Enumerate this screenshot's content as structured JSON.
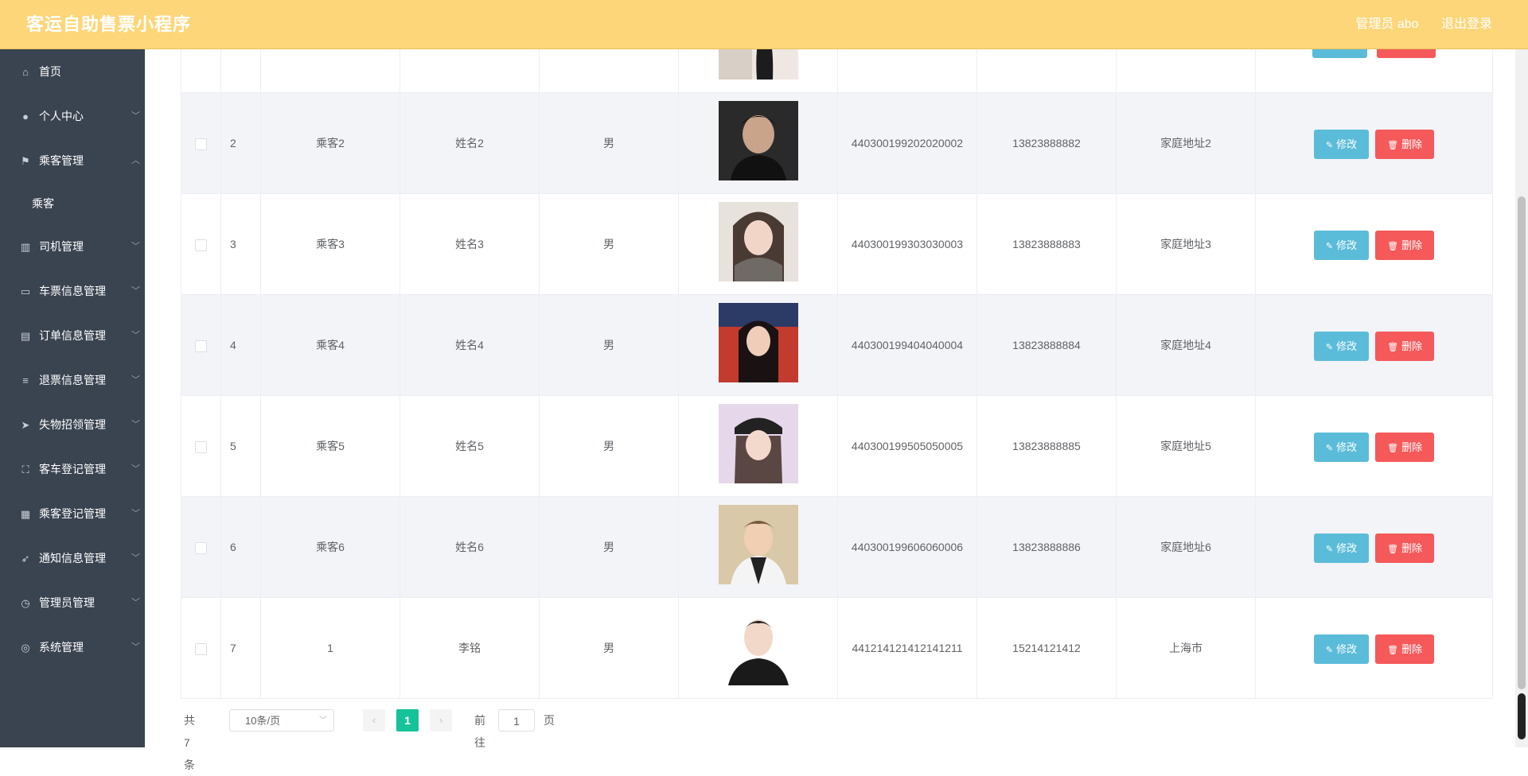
{
  "header": {
    "title": "客运自助售票小程序",
    "user_label": "管理员 abo",
    "logout_label": "退出登录"
  },
  "sidebar": {
    "items": [
      {
        "label": "首页",
        "icon": "home-icon",
        "glyph": "⌂",
        "chevron": ""
      },
      {
        "label": "个人中心",
        "icon": "user-icon",
        "glyph": "●",
        "chevron": "﹀"
      },
      {
        "label": "乘客管理",
        "icon": "flag-icon",
        "glyph": "⚑",
        "chevron": "︿"
      },
      {
        "label": "司机管理",
        "icon": "chart-icon",
        "glyph": "▥",
        "chevron": "﹀"
      },
      {
        "label": "车票信息管理",
        "icon": "chat-icon",
        "glyph": "▭",
        "chevron": "﹀"
      },
      {
        "label": "订单信息管理",
        "icon": "clipboard-icon",
        "glyph": "▤",
        "chevron": "﹀"
      },
      {
        "label": "退票信息管理",
        "icon": "list-icon",
        "glyph": "≡",
        "chevron": "﹀"
      },
      {
        "label": "失物招领管理",
        "icon": "send-icon",
        "glyph": "➤",
        "chevron": "﹀"
      },
      {
        "label": "客车登记管理",
        "icon": "fullscreen-icon",
        "glyph": "⛶",
        "chevron": "﹀"
      },
      {
        "label": "乘客登记管理",
        "icon": "grid-icon",
        "glyph": "▦",
        "chevron": "﹀"
      },
      {
        "label": "通知信息管理",
        "icon": "navigation-icon",
        "glyph": "➶",
        "chevron": "﹀"
      },
      {
        "label": "管理员管理",
        "icon": "clock-icon",
        "glyph": "◷",
        "chevron": "﹀"
      },
      {
        "label": "系统管理",
        "icon": "compass-icon",
        "glyph": "◎",
        "chevron": "﹀"
      }
    ],
    "submenu_active": "乘客"
  },
  "table": {
    "rows": [
      {
        "index": "2",
        "username": "乘客2",
        "name": "姓名2",
        "sex": "男",
        "id_card": "440300199202020002",
        "phone": "13823888882",
        "address": "家庭地址2"
      },
      {
        "index": "3",
        "username": "乘客3",
        "name": "姓名3",
        "sex": "男",
        "id_card": "440300199303030003",
        "phone": "13823888883",
        "address": "家庭地址3"
      },
      {
        "index": "4",
        "username": "乘客4",
        "name": "姓名4",
        "sex": "男",
        "id_card": "440300199404040004",
        "phone": "13823888884",
        "address": "家庭地址4"
      },
      {
        "index": "5",
        "username": "乘客5",
        "name": "姓名5",
        "sex": "男",
        "id_card": "440300199505050005",
        "phone": "13823888885",
        "address": "家庭地址5"
      },
      {
        "index": "6",
        "username": "乘客6",
        "name": "姓名6",
        "sex": "男",
        "id_card": "440300199606060006",
        "phone": "13823888886",
        "address": "家庭地址6"
      },
      {
        "index": "7",
        "username": "1",
        "name": "李铭",
        "sex": "男",
        "id_card": "441214121412141211",
        "phone": "15214121412",
        "address": "上海市"
      }
    ],
    "edit_label": "修改",
    "delete_label": "删除"
  },
  "pagination": {
    "total": "共 7 条",
    "page_size": "10条/页",
    "current_page": "1",
    "goto_label": "前往",
    "goto_value": "1",
    "page_unit": "页"
  },
  "colors": {
    "header_bg": "#fdd679",
    "sidebar_bg": "#3a4350",
    "edit_button": "#5bbcd9",
    "delete_button": "#f5595a",
    "active_page": "#16c29a"
  }
}
